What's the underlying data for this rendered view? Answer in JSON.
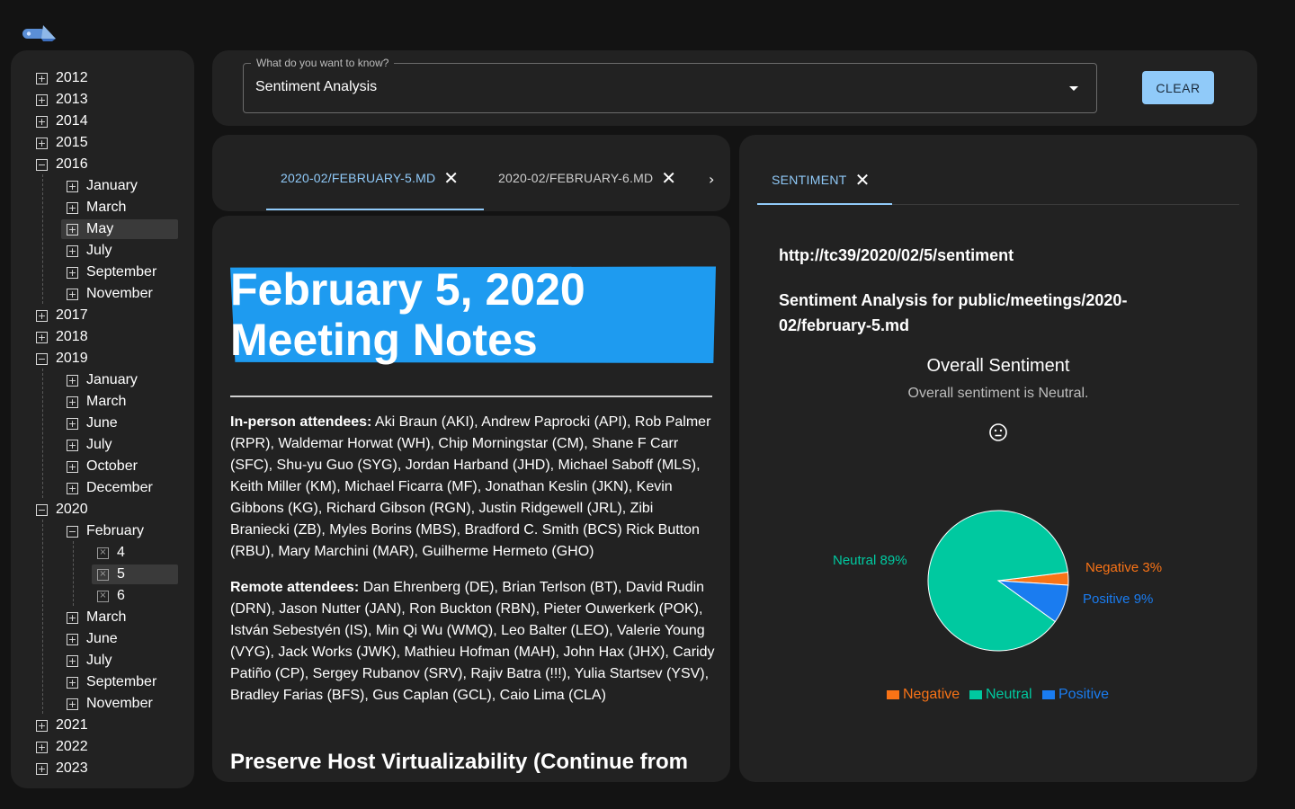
{
  "sidebar": {
    "years": [
      {
        "label": "2012"
      },
      {
        "label": "2013"
      },
      {
        "label": "2014"
      },
      {
        "label": "2015"
      },
      {
        "label": "2016",
        "months": [
          "January",
          "March",
          "May",
          "July",
          "September",
          "November"
        ]
      },
      {
        "label": "2017"
      },
      {
        "label": "2018"
      },
      {
        "label": "2019",
        "months": [
          "January",
          "March",
          "June",
          "July",
          "October",
          "December"
        ]
      },
      {
        "label": "2020",
        "months": [
          "February",
          "March",
          "June",
          "July",
          "September",
          "November"
        ],
        "days": [
          "4",
          "5",
          "6"
        ]
      },
      {
        "label": "2021"
      },
      {
        "label": "2022"
      },
      {
        "label": "2023"
      }
    ]
  },
  "query": {
    "legend": "What do you want to know?",
    "value": "Sentiment Analysis",
    "clear_label": "CLEAR"
  },
  "doc_tabs": [
    {
      "label": "2020-02/FEBRUARY-5.MD",
      "active": true
    },
    {
      "label": "2020-02/FEBRUARY-6.MD",
      "active": false
    }
  ],
  "doc": {
    "title": "February 5, 2020 Meeting Notes",
    "inperson_label": "In-person attendees:",
    "inperson_text": " Aki Braun (AKI), Andrew Paprocki (API), Rob Palmer (RPR), Waldemar Horwat (WH), Chip Morningstar (CM), Shane F Carr (SFC), Shu-yu Guo (SYG), Jordan Harband (JHD), Michael Saboff (MLS), Keith Miller (KM), Michael Ficarra (MF), Jonathan Keslin (JKN), Kevin Gibbons (KG), Richard Gibson (RGN), Justin Ridgewell (JRL), Zibi Braniecki (ZB), Myles Borins (MBS), Bradford C. Smith (BCS) Rick Button (RBU), Mary Marchini (MAR), Guilherme Hermeto (GHO)",
    "remote_label": "Remote attendees:",
    "remote_text": " Dan Ehrenberg (DE), Brian Terlson (BT), David Rudin (DRN), Jason Nutter (JAN), Ron Buckton (RBN), Pieter Ouwerkerk (POK), István Sebestyén (IS), Min Qi Wu (WMQ), Leo Balter (LEO), Valerie Young (VYG), Jack Works (JWK), Mathieu Hofman (MAH), John Hax (JHX), Caridy Patiño (CP), Sergey Rubanov (SRV), Rajiv Batra (!!!), Yulia Startsev (YSV), Bradley Farias (BFS), Gus Caplan (GCL), Caio Lima (CLA)",
    "next_heading": "Preserve Host Virtualizability (Continue from"
  },
  "sentiment": {
    "tab_label": "SENTIMENT",
    "url": "http://tc39/2020/02/5/sentiment",
    "heading": "Sentiment Analysis for public/meetings/2020-02/february-5.md",
    "overall_title": "Overall Sentiment",
    "overall_text": "Overall sentiment is Neutral.",
    "face_icon": "neutral-face-icon"
  },
  "chart_data": {
    "type": "pie",
    "slices": [
      {
        "name": "Negative",
        "value": 3,
        "label": "Negative 3%",
        "color": "#f97316"
      },
      {
        "name": "Neutral",
        "value": 89,
        "label": "Neutral 89%",
        "color": "#00c9a0"
      },
      {
        "name": "Positive",
        "value": 9,
        "label": "Positive 9%",
        "color": "#1a7cf0"
      }
    ],
    "legend": [
      "Negative",
      "Neutral",
      "Positive"
    ],
    "legend_position": "bottom"
  },
  "colors": {
    "accent": "#90caf9",
    "title_highlight": "#1e9bf0",
    "panel": "#222222",
    "background": "#131313"
  }
}
